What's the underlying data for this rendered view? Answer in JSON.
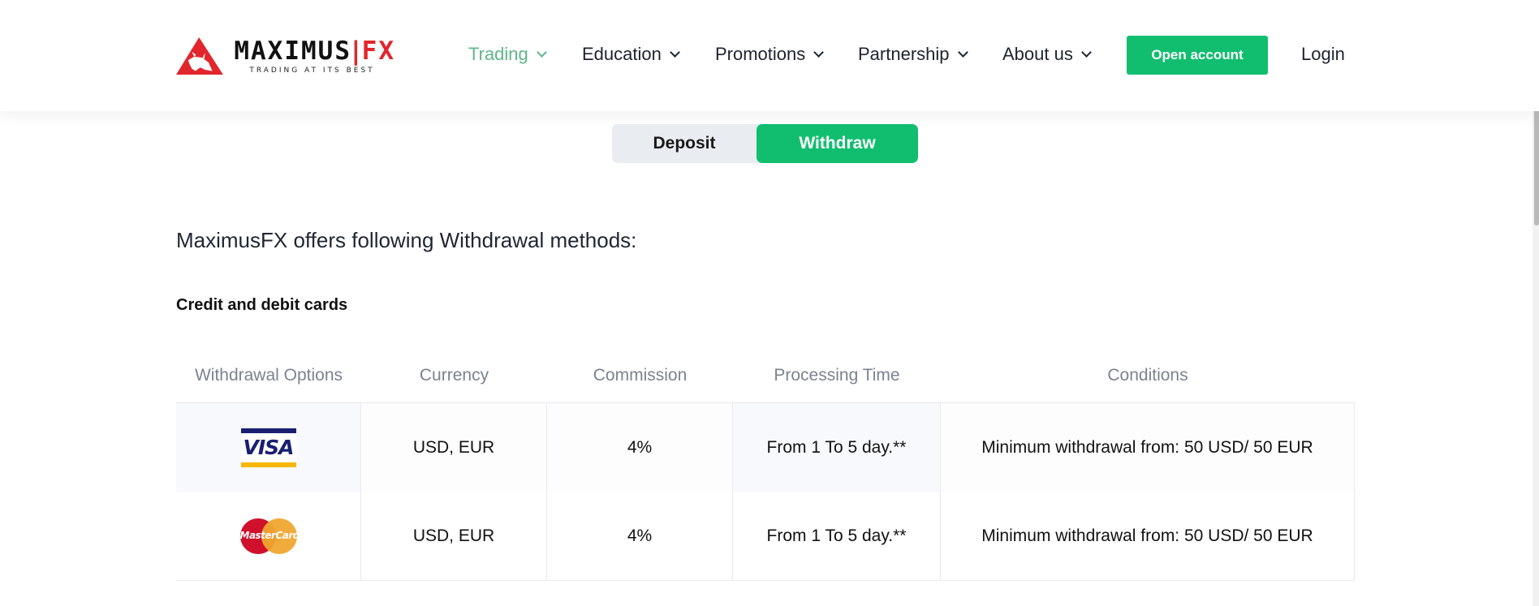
{
  "brand": {
    "name_main": "MAXIMUS",
    "name_sep": "|",
    "name_fx": "FX",
    "tagline": "TRADING AT ITS BEST",
    "colors": {
      "accent": "#11be6f",
      "brand_red": "#e1262d",
      "nav_active": "#5fb58a"
    }
  },
  "nav": {
    "items": [
      {
        "label": "Trading",
        "active": true
      },
      {
        "label": "Education"
      },
      {
        "label": "Promotions"
      },
      {
        "label": "Partnership"
      },
      {
        "label": "About us"
      }
    ],
    "open_account": "Open account",
    "login": "Login"
  },
  "toggle": {
    "deposit": "Deposit",
    "withdraw": "Withdraw",
    "selected": "Withdraw"
  },
  "page_title": "MaximusFX offers following Withdrawal methods:",
  "section_title": "Credit and debit cards",
  "table": {
    "headers": [
      "Withdrawal Options",
      "Currency",
      "Commission",
      "Processing Time",
      "Conditions"
    ],
    "rows": [
      {
        "option": "VISA",
        "currency": "USD, EUR",
        "commission": "4%",
        "processing": "From 1 To 5 day.**",
        "conditions": "Minimum withdrawal from: 50 USD/ 50 EUR"
      },
      {
        "option": "MasterCard",
        "currency": "USD, EUR",
        "commission": "4%",
        "processing": "From 1 To 5 day.**",
        "conditions": "Minimum withdrawal from: 50 USD/ 50 EUR"
      }
    ]
  }
}
